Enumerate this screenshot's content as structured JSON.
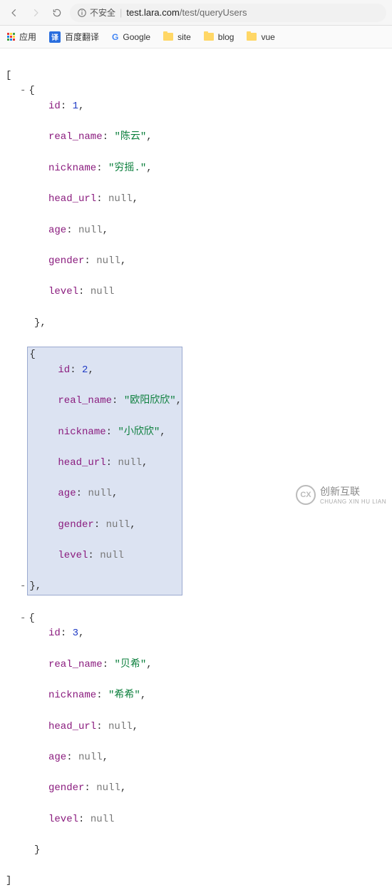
{
  "browser": {
    "insecure_label": "不安全",
    "url_host": "test.lara.com",
    "url_path": "/test/queryUsers"
  },
  "bookmarks": {
    "apps": "应用",
    "baidu": "百度翻译",
    "baidu_badge": "译",
    "google": "Google",
    "folders": [
      "site",
      "blog",
      "vue"
    ]
  },
  "json": {
    "open": "[",
    "close": "]",
    "obj_open": "{",
    "obj_close": "}",
    "obj_close_comma": "},",
    "key_id": "id",
    "key_real": "real_name",
    "key_nick": "nickname",
    "key_head": "head_url",
    "key_age": "age",
    "key_gender": "gender",
    "key_level": "level",
    "null": "null",
    "items": [
      {
        "id": "1",
        "real_name": "\"陈云\"",
        "nickname": "\"穷摇.\""
      },
      {
        "id": "2",
        "real_name": "\"欧阳欣欣\"",
        "nickname": "\"小欣欣\""
      },
      {
        "id": "3",
        "real_name": "\"贝希\"",
        "nickname": "\"希希\""
      }
    ]
  },
  "watermark": {
    "logo": "CX",
    "zh": "创新互联",
    "en": "CHUANG XIN HU LIAN"
  }
}
